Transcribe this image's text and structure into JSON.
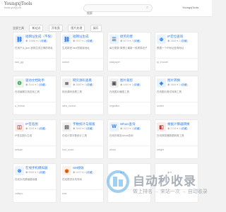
{
  "header": {
    "logo_line1": "YoungxjTools",
    "logo_line2": "tools.yoxyj.cn",
    "search_placeholder": "搜索",
    "user_label": "YoungxjTools"
  },
  "breadcrumb": [
    "全部工具",
    "新站点",
    "开发类",
    "图片处理",
    "娱乐"
  ],
  "cards": [
    {
      "title": "短网址生成（不限）",
      "icon": "⛓",
      "icon_color": "#2c7be5",
      "icon_bg": "#eaf2fd",
      "views": "10888",
      "likes": "2",
      "btn": "(收藏)",
      "desc": "在用户从 json.官网生成正确的网址",
      "tag": "dwz_gg"
    },
    {
      "title": "短网址生成",
      "icon": "⛓",
      "icon_color": "#2c7be5",
      "icon_bg": "#eaf2fd",
      "views": "9297",
      "likes": "2",
      "btn": "(收藏)",
      "desc": "生成新浪 dwz短链接地址",
      "tag": "dwzurl"
    },
    {
      "title": "搞笑的壁",
      "icon": "☰",
      "icon_color": "#2c7be5",
      "icon_bg": "#eaf2fd",
      "views": "6478",
      "likes": "2",
      "btn": "(收藏)",
      "desc": "每日更新 微博上最新一段搞笑段子",
      "tag": "wallpaper"
    },
    {
      "title": "IP定位查询",
      "icon": "⊕",
      "icon_color": "#2c7be5",
      "icon_bg": "#eaf2fd",
      "views": "2668",
      "likes": "2",
      "btn": "(收藏)",
      "desc": "根据一个IP地址查询地址",
      "tag": "ip_encode"
    },
    {
      "title": "驱动文档助手",
      "icon": "❂",
      "icon_color": "#3aa757",
      "icon_bg": "#e8f6ec",
      "views": "3044",
      "likes": "2",
      "btn": "(收藏)",
      "desc": "在线编辑文档查找工具",
      "tag": "a_format"
    },
    {
      "title": "网页源码查看",
      "icon": "≣",
      "icon_color": "#555",
      "icon_bg": "#f0f0f0",
      "views": "2885",
      "likes": "1",
      "btn": "(收藏)",
      "desc": "网页源码查看工具",
      "tag": "view_source"
    },
    {
      "title": "图片裁剪",
      "icon": "▣",
      "icon_color": "#555",
      "icon_bg": "#f0f0f0",
      "views": "4450",
      "likes": "1",
      "btn": "(收藏)",
      "desc": "在线图片截图工具",
      "tag": "imgeditor"
    },
    {
      "title": "图片转换",
      "icon": "◈",
      "icon_color": "#2c7be5",
      "icon_bg": "#eaf2fd",
      "views": "3668",
      "likes": "2",
      "btn": "(收藏)",
      "desc": "在线图片格式转换工具",
      "tag": "sorted"
    },
    {
      "title": "IP签名图",
      "icon": "◫",
      "icon_color": "#c0392b",
      "icon_bg": "#fbeaea",
      "views": "3208",
      "likes": "1",
      "btn": "(收藏)",
      "desc": "IP签名图片生成",
      "tag": "heiluan"
    },
    {
      "title": "字数统计与排版",
      "icon": "▤",
      "icon_color": "#555",
      "icon_bg": "#f0f0f0",
      "views": "3568",
      "likes": "2",
      "btn": "(收藏)",
      "desc": "在线计算字数统计工具",
      "tag": "font_count"
    },
    {
      "title": "Whois查询",
      "icon": "W",
      "icon_color": "#2c7be5",
      "icon_bg": "#eaf2fd",
      "views": "2604",
      "likes": "1",
      "btn": "(收藏)",
      "desc": "在线的域名whois查询",
      "tag": "whois"
    },
    {
      "title": "根据计算器转换",
      "icon": "◧",
      "icon_color": "#c0392b",
      "icon_bg": "#fbeaea",
      "views": "5708",
      "likes": "1",
      "btn": "(收藏)",
      "desc": "在线换算器数据转换工具",
      "tag": "weight"
    },
    {
      "title": "在线手机模拟器",
      "icon": "⊗",
      "icon_color": "#2c7be5",
      "icon_bg": "#eaf2fd",
      "views": "5958",
      "likes": "2",
      "btn": "(收藏)",
      "desc": "在线手机屏幕模拟器",
      "tag": "voltepo"
    },
    {
      "title": "SM接收",
      "icon": "◉",
      "icon_color": "#d35400",
      "icon_bg": "#fdf0e6",
      "views": "9207",
      "likes": "1",
      "btn": "(收藏)",
      "desc": "在线提供手机号码",
      "tag": "sms"
    },
    {
      "title": "",
      "icon": "",
      "icon_color": "#ccc",
      "icon_bg": "#fff",
      "views": "",
      "likes": "",
      "btn": "",
      "desc": "",
      "tag": ""
    },
    {
      "title": "",
      "icon": "",
      "icon_color": "#ccc",
      "icon_bg": "#fff",
      "views": "",
      "likes": "",
      "btn": "",
      "desc": "",
      "tag": ""
    }
  ],
  "watermark": {
    "title": "自动秒收录",
    "subtitle": "做上排名 → 来站一次 → 自动收录"
  }
}
